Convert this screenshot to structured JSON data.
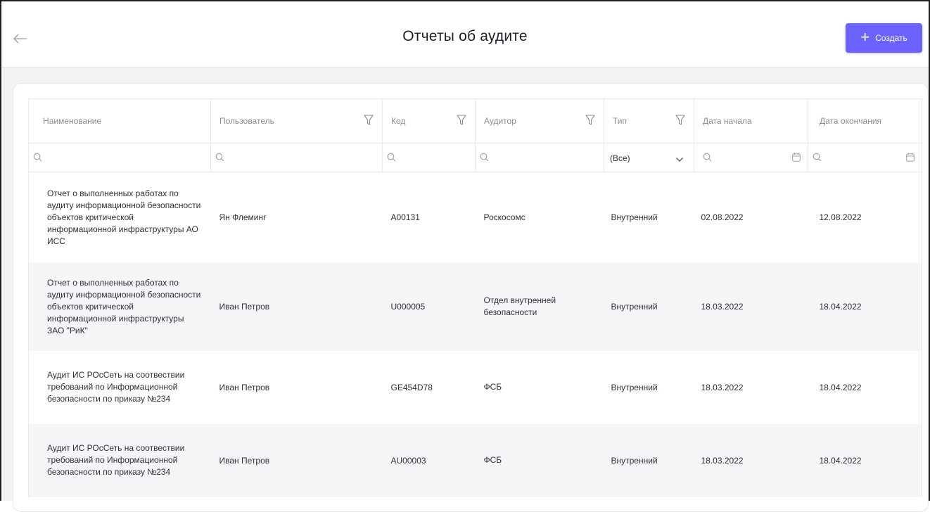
{
  "header": {
    "title": "Отчеты об аудите",
    "create_label": "Создать"
  },
  "table": {
    "columns": [
      {
        "label": "Наименование"
      },
      {
        "label": "Пользователь"
      },
      {
        "label": "Код"
      },
      {
        "label": "Аудитор"
      },
      {
        "label": "Тип"
      },
      {
        "label": "Дата начала"
      },
      {
        "label": "Дата окончания"
      }
    ],
    "type_filter_value": "(Все)",
    "rows": [
      {
        "name": "Отчет о выполненных работах по аудиту информационной безопасности объектов критической информационной инфраструктуры АО ИСС",
        "user": "Ян Флеминг",
        "code": "A00131",
        "auditor": "Роскосомс",
        "type": "Внутренний",
        "start": "02.08.2022",
        "end": "12.08.2022"
      },
      {
        "name": "Отчет о выполненных работах по аудиту информационной безопасности объектов критической информационной инфраструктуры ЗАО \"РиК\"",
        "user": "Иван Петров",
        "code": "U000005",
        "auditor": "Отдел внутренней безопасности",
        "type": "Внутренний",
        "start": "18.03.2022",
        "end": "18.04.2022"
      },
      {
        "name": "Аудит ИС РОсСеть на соотвествии требований по Информационной безопасности по приказу №234",
        "user": "Иван Петров",
        "code": "GE454D78",
        "auditor": "ФСБ",
        "type": "Внутренний",
        "start": "18.03.2022",
        "end": "18.04.2022"
      },
      {
        "name": "Аудит ИС РОсСеть на соотвествии требований по Информационной безопасности по приказу №234",
        "user": "Иван Петров",
        "code": "AU00003",
        "auditor": "ФСБ",
        "type": "Внутренний",
        "start": "18.03.2022",
        "end": "18.04.2022"
      }
    ]
  },
  "colors": {
    "accent": "#6c63ff",
    "row_alt": "#f4f5f7",
    "border": "#e6e8ec"
  }
}
